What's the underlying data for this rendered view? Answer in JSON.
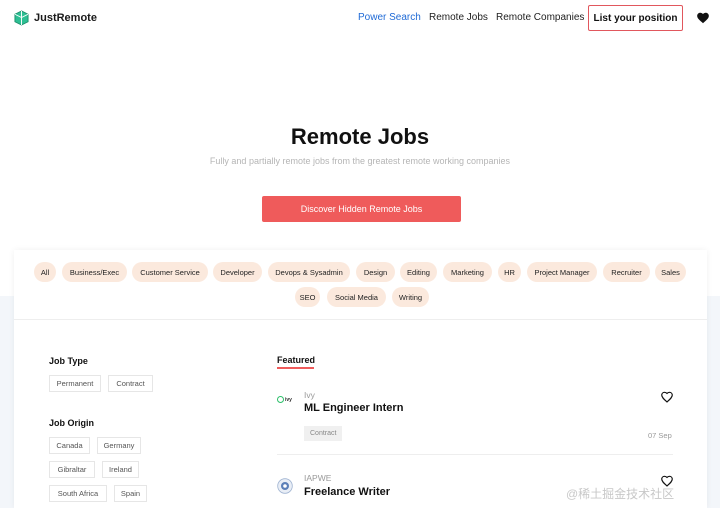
{
  "header": {
    "brand": "JustRemote",
    "nav": [
      "Power Search",
      "Remote Jobs",
      "Remote Companies"
    ],
    "list_button": "List your position"
  },
  "hero": {
    "title": "Remote Jobs",
    "subtitle": "Fully and partially remote jobs from the greatest remote working companies",
    "cta": "Discover Hidden Remote Jobs"
  },
  "categories": [
    "All",
    "Business/Exec",
    "Customer Service",
    "Developer",
    "Devops & Sysadmin",
    "Design",
    "Editing",
    "Marketing",
    "HR",
    "Project Manager",
    "Recruiter",
    "Sales",
    "SEO",
    "Social Media",
    "Writing"
  ],
  "filters": {
    "job_type_title": "Job Type",
    "job_types": [
      "Permanent",
      "Contract"
    ],
    "job_origin_title": "Job Origin",
    "origins": [
      "Canada",
      "Germany",
      "Gibraltar",
      "Ireland",
      "South Africa",
      "Spain"
    ]
  },
  "featured": {
    "label": "Featured",
    "jobs": [
      {
        "company": "Ivy",
        "logo_text": "ivy",
        "title": "ML Engineer Intern",
        "tag": "Contract",
        "date": "07 Sep"
      },
      {
        "company": "IAPWE",
        "title": "Freelance Writer"
      }
    ]
  },
  "watermark": "@稀土掘金技术社区",
  "colors": {
    "accent": "#ef5b5b",
    "nav_active": "#1f6ad6",
    "chip_bg": "#fbe9dd"
  }
}
